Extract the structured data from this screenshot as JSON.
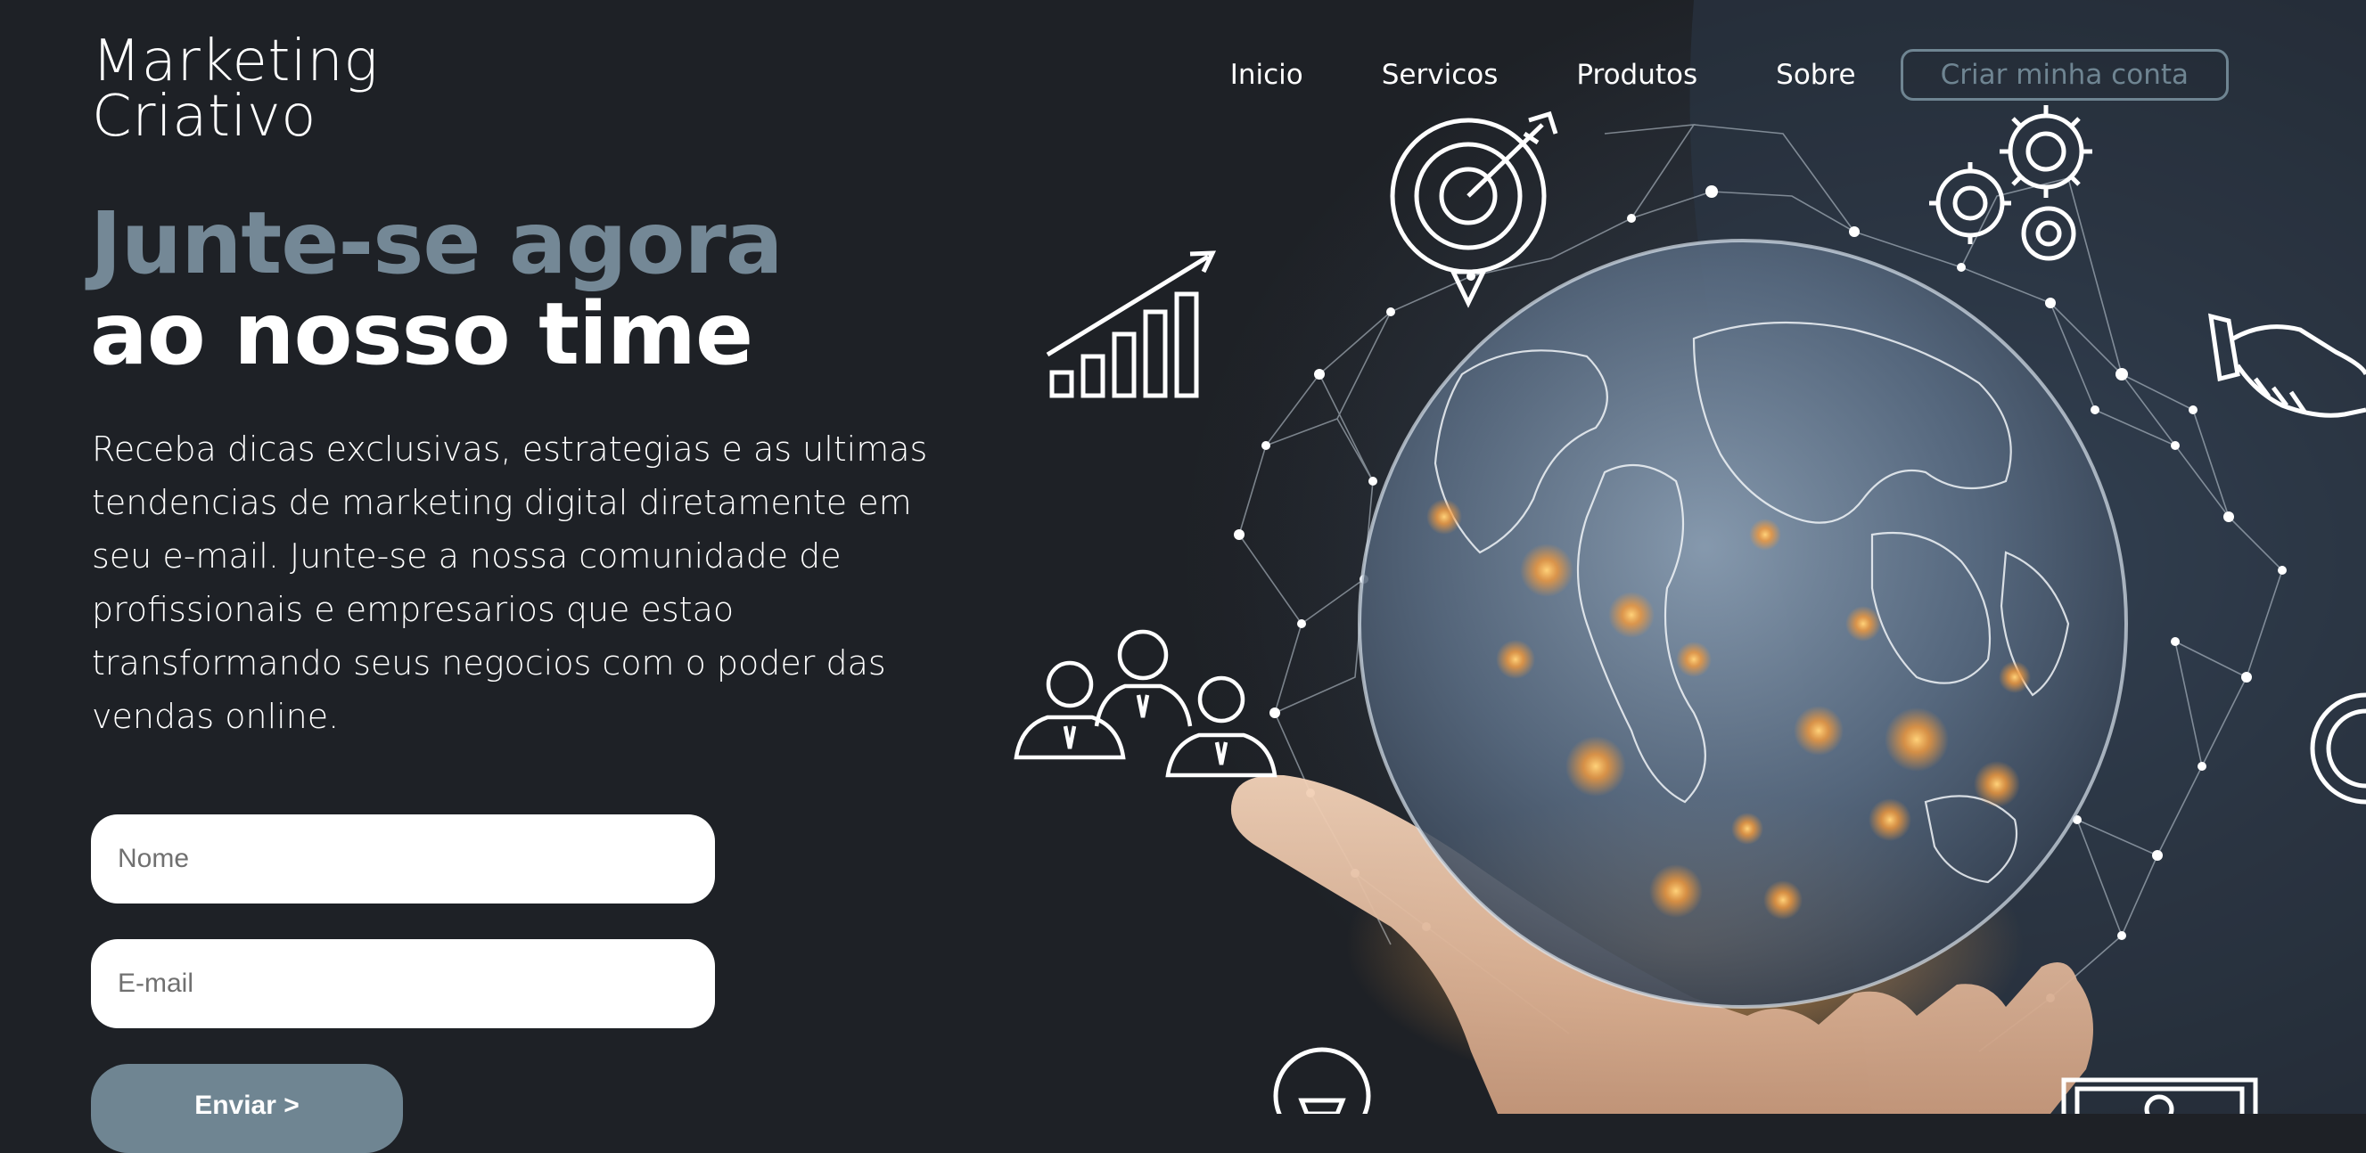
{
  "brand": {
    "line1": "Marketing",
    "line2": "Criativo"
  },
  "nav": {
    "items": [
      "Inicio",
      "Servicos",
      "Produtos",
      "Sobre"
    ],
    "cta_label": "Criar minha conta"
  },
  "hero": {
    "headline_line1": "Junte-se agora",
    "headline_line2": "ao nosso time",
    "description": "Receba dicas exclusivas, estrategias e as ultimas tendencias de marketing digital diretamente em seu e-mail. Junte-se a nossa comunidade de profissionais e empresarios que estao transformando seus negocios com o poder das vendas online."
  },
  "form": {
    "name_placeholder": "Nome",
    "email_placeholder": "E-mail",
    "submit_label": "Enviar >"
  },
  "colors": {
    "background": "#1e2126",
    "accent": "#748896",
    "text": "#ffffff",
    "input_bg": "#ffffff"
  },
  "icons": [
    "target-icon",
    "gears-icon",
    "growth-chart-icon",
    "handshake-icon",
    "team-icon",
    "globe-icon",
    "hand-icon",
    "coin-icon",
    "trophy-icon",
    "money-icon"
  ]
}
